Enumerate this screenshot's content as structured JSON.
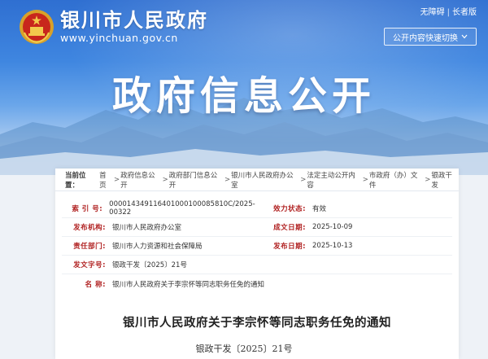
{
  "header": {
    "site_title": "银川市人民政府",
    "site_url": "www.yinchuan.gov.cn",
    "top_links": [
      "无障碍",
      "长者版"
    ],
    "quick_switch_label": "公开内容快速切换",
    "hero_title": "政府信息公开"
  },
  "breadcrumb": {
    "label": "当前位置：",
    "items": [
      "首页",
      "政府信息公开",
      "政府部门信息公开",
      "银川市人民政府办公室",
      "法定主动公开内容",
      "市政府（办）文件",
      "银政干发"
    ]
  },
  "meta": {
    "index_label": "索 引 号:",
    "index_value": "000014349116401000100085810C/2025-00322",
    "status_label": "效力状态:",
    "status_value": "有效",
    "publisher_label": "发布机构:",
    "publisher_value": "银川市人民政府办公室",
    "date_label": "成文日期:",
    "date_value": "2025-10-09",
    "responsible_label": "责任部门:",
    "responsible_value": "银川市人力资源和社会保障局",
    "publish_date_label": "发布日期:",
    "publish_date_value": "2025-10-13",
    "docno_label": "发文字号:",
    "docno_value": "银政干发〔2025〕21号",
    "name_label": "名 称:",
    "name_value": "银川市人民政府关于李宗怀等同志职务任免的通知"
  },
  "document": {
    "title": "银川市人民政府关于李宗怀等同志职务任免的通知",
    "number": "银政干发〔2025〕21号"
  },
  "colors": {
    "brand_blue": "#2f6fd1",
    "label_red": "#b02020"
  }
}
